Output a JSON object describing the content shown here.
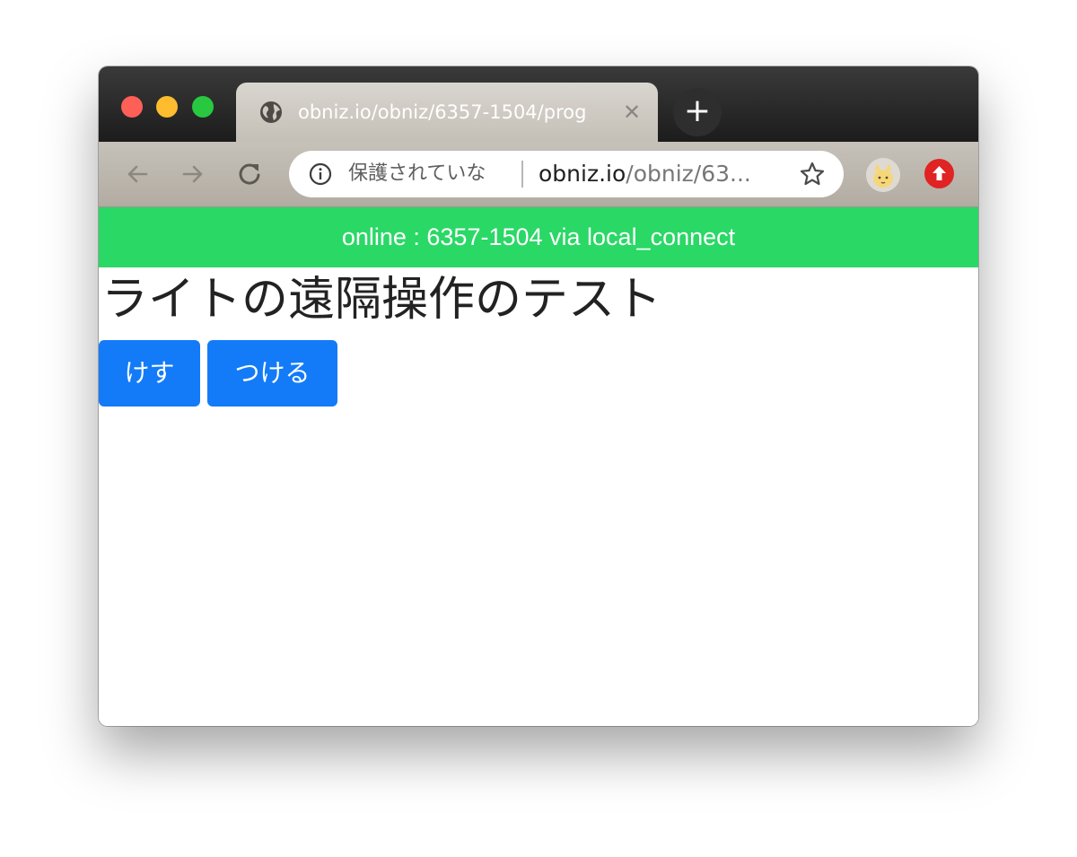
{
  "browser": {
    "tab": {
      "title": "obniz.io/obniz/6357-1504/prog",
      "close_glyph": "✕",
      "icon": "globe-icon"
    },
    "new_tab_glyph": "+",
    "omnibox": {
      "security_text": "保護されていな",
      "url_host": "obniz.io",
      "url_path": "/obniz/63..."
    },
    "icons": [
      "back-arrow-icon",
      "forward-arrow-icon",
      "reload-icon",
      "info-icon",
      "star-icon",
      "profile-avatar-icon",
      "extension-upload-icon"
    ],
    "colors": {
      "titlebar": "#1c1c1c",
      "tab": "#c9c4bc",
      "toolbar": "#b8b2a9"
    }
  },
  "page": {
    "status_text": "online : 6357-1504 via local_connect",
    "title": "ライトの遠隔操作のテスト",
    "buttons": {
      "off_label": "けす",
      "on_label": "つける"
    },
    "colors": {
      "status_bar": "#2ad866",
      "button": "#137bf8",
      "title_text": "#222222"
    }
  }
}
